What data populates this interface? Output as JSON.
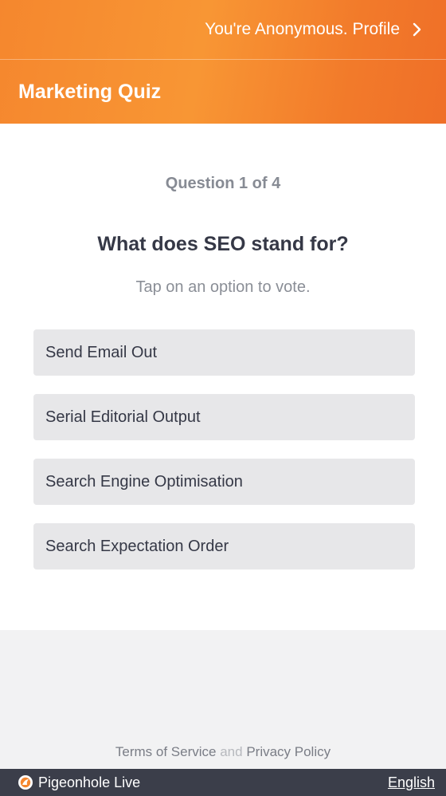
{
  "header": {
    "profile_text": "You're Anonymous. Profile",
    "title": "Marketing Quiz"
  },
  "quiz": {
    "progress": "Question 1 of 4",
    "question": "What does SEO stand for?",
    "hint": "Tap on an option to vote.",
    "options": [
      "Send Email Out",
      "Serial Editorial Output",
      "Search Engine Optimisation",
      "Search Expectation Order"
    ]
  },
  "legal": {
    "terms": "Terms of Service",
    "conjunction": "and",
    "privacy": "Privacy Policy"
  },
  "footer": {
    "brand": "Pigeonhole Live",
    "language": "English"
  },
  "colors": {
    "brand_orange": "#f5872e",
    "footer_bg": "#3b3e4a"
  }
}
